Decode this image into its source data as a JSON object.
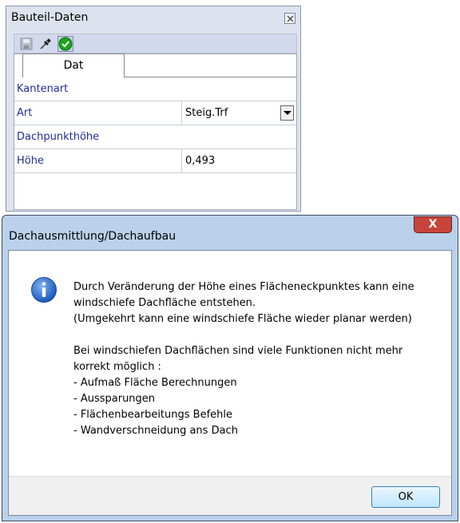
{
  "panel": {
    "title": "Bauteil-Daten",
    "tab_label": "Dat",
    "sections": [
      {
        "title": "Kantenart"
      },
      {
        "title": "Dachpunkthöhe"
      }
    ],
    "rows": {
      "art": {
        "label": "Art",
        "value": "Steig.Trf"
      },
      "hoehe": {
        "label": "Höhe",
        "value": "0,493"
      }
    },
    "icons": [
      "save-icon",
      "pin-icon",
      "checkmark-icon",
      "close-icon"
    ],
    "colors": {
      "accent": "#1f2e98",
      "ok_green": "#1aa81a"
    }
  },
  "dialog": {
    "title": "Dachausmittlung/Dachaufbau",
    "close_label": "X",
    "message": {
      "para1": [
        "Durch Veränderung der Höhe eines Flächeneckpunktes kann eine",
        "windschiefe Dachfläche entstehen.",
        "(Umgekehrt kann eine windschiefe Fläche wieder planar werden)"
      ],
      "para2": [
        "Bei windschiefen Dachflächen sind viele Funktionen nicht mehr",
        "korrekt möglich :",
        "- Aufmaß Fläche Berechnungen",
        "- Aussparungen",
        "- Flächenbearbeitungs Befehle",
        "- Wandverschneidung ans Dach"
      ]
    },
    "ok_label": "OK",
    "icon": "info-icon",
    "colors": {
      "close": "#c7443a",
      "frame": "#b9d1ea"
    }
  }
}
